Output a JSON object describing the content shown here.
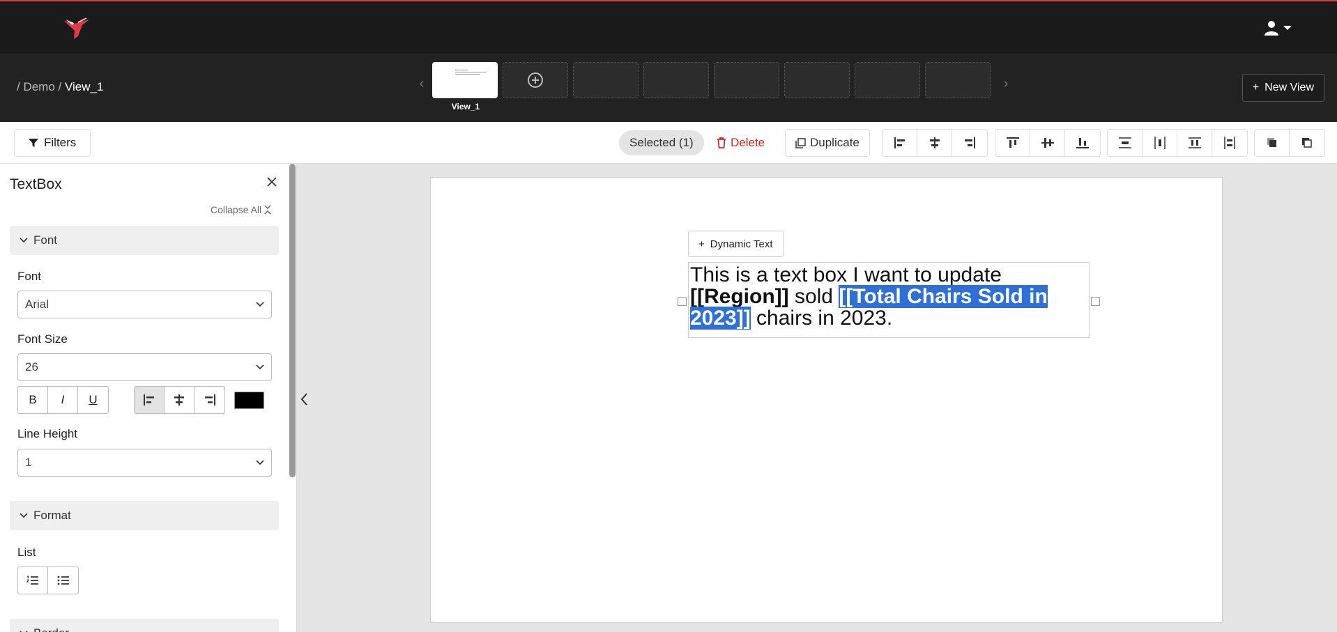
{
  "app": {
    "brand_color": "#d9393f"
  },
  "breadcrumb": {
    "prefix": "/ Demo /",
    "current": "View_1"
  },
  "views": {
    "active_label": "View_1",
    "new_view_label": "New View"
  },
  "toolbar": {
    "filters_label": "Filters",
    "selected_label": "Selected (1)",
    "delete_label": "Delete",
    "duplicate_label": "Duplicate"
  },
  "panel": {
    "title": "TextBox",
    "collapse_all": "Collapse All",
    "font_section": "Font",
    "font_label": "Font",
    "font_value": "Arial",
    "font_size_label": "Font Size",
    "font_size_value": "26",
    "bold": "B",
    "italic": "I",
    "underline": "U",
    "line_height_label": "Line Height",
    "line_height_value": "1",
    "format_section": "Format",
    "list_label": "List",
    "border_section": "Border"
  },
  "canvas": {
    "dynamic_text_label": "Dynamic Text",
    "text_part1": "This is a text box I want to update ",
    "text_region": "[[Region]]",
    "text_sold": " sold ",
    "text_highlight": "[[Total Chairs Sold in 2023]]",
    "text_end": " chairs in 2023."
  }
}
